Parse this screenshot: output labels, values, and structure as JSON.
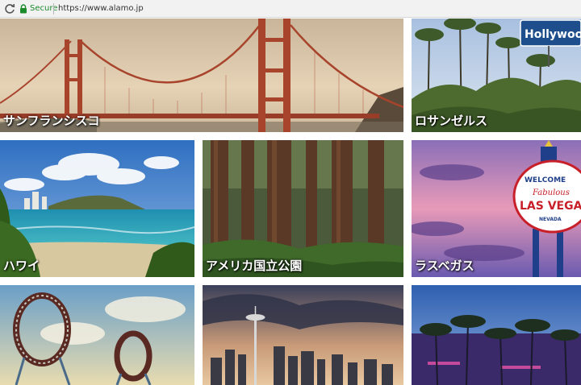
{
  "browser": {
    "secure_label": "Secure",
    "url": "https://www.alamo.jp"
  },
  "tiles": [
    {
      "id": "san-francisco",
      "label": "サンフランシスコ"
    },
    {
      "id": "los-angeles",
      "label": "ロサンゼルス",
      "sign_text": "Hollywood"
    },
    {
      "id": "hawaii",
      "label": "ハワイ"
    },
    {
      "id": "national-parks",
      "label": "アメリカ国立公園"
    },
    {
      "id": "las-vegas",
      "label": "ラスベガス",
      "sign_welcome": "WELCOME",
      "sign_fabulous": "Fabulous",
      "sign_city": "LAS VEGAS",
      "sign_state": "NEVADA"
    },
    {
      "id": "orlando",
      "label": ""
    },
    {
      "id": "seattle",
      "label": ""
    },
    {
      "id": "miami",
      "label": ""
    }
  ],
  "colors": {
    "secure_green": "#1a8a2a",
    "bridge_red": "#a8432c"
  }
}
